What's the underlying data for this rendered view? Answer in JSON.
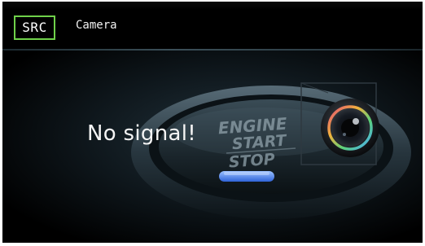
{
  "header": {
    "source_button_label": "SRC",
    "title": "Camera"
  },
  "status": {
    "message": "No signal!"
  },
  "background": {
    "button_text_line1": "ENGINE",
    "button_text_line2": "START",
    "button_text_line3": "STOP",
    "lens_accent_colors": [
      "#e04a7a",
      "#f3b23c",
      "#5ad07a",
      "#4aa9ff"
    ]
  },
  "colors": {
    "screen_bg": "#000000",
    "src_border": "#6fd14a",
    "text": "#f4f4f4",
    "indicator": "#3c7cff"
  }
}
